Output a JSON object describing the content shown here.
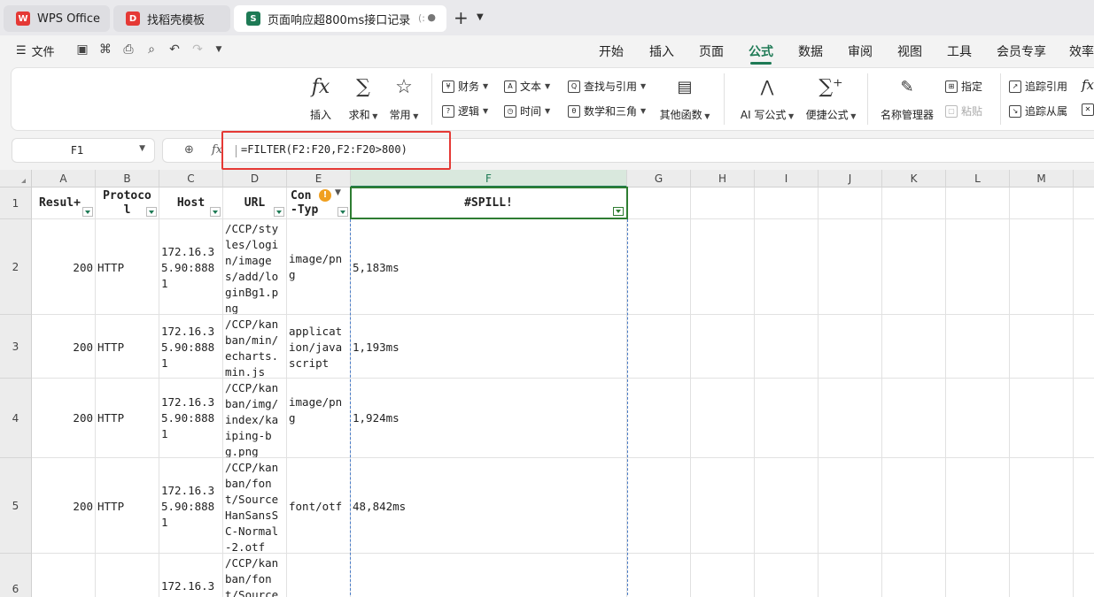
{
  "colors": {
    "accent": "#1e7a55",
    "highlight": "#e53935",
    "spill_border": "#4a7cc7",
    "warning": "#f0a020"
  },
  "tabs": {
    "wps": "WPS Office",
    "templates": "找稻壳模板",
    "doc": "页面响应超800ms接口记录",
    "doc_extra": "(: "
  },
  "menu": {
    "file": "文件",
    "tabs": [
      "开始",
      "插入",
      "页面",
      "公式",
      "数据",
      "审阅",
      "视图",
      "工具",
      "会员专享",
      "效率"
    ],
    "active": "公式"
  },
  "ribbon": {
    "insert": "插入",
    "sum": "求和",
    "common": "常用",
    "finance": "财务",
    "text": "文本",
    "lookup": "查找与引用",
    "other_funcs": "其他函数",
    "logic": "逻辑",
    "time": "时间",
    "math": "数学和三角",
    "ai_formula": "AI 写公式",
    "quick_formula": "便捷公式",
    "name_manager": "名称管理器",
    "assign": "指定",
    "paste": "粘贴",
    "trace_precedents": "追踪引用",
    "trace_dependents": "追踪从属",
    "fx_symbol": "fx",
    "sum_symbol": "∑"
  },
  "formula_bar": {
    "name_box": "F1",
    "formula": "=FILTER(F2:F20,F2:F20>800)",
    "fx_label": "fx"
  },
  "sheet": {
    "columns": [
      "A",
      "B",
      "C",
      "D",
      "E",
      "F",
      "G",
      "H",
      "I",
      "J",
      "K",
      "L",
      "M"
    ],
    "rows": [
      "1",
      "2",
      "3",
      "4",
      "5",
      "6"
    ],
    "headers": {
      "A": "Resul+",
      "B": "Protoco l",
      "C": "Host",
      "D": "URL",
      "E": "Con -Type",
      "F": "#SPILL!"
    },
    "data": [
      {
        "a": "200",
        "b": "HTTP",
        "c": "172.16.35.90:8881",
        "d": "/CCP/styles/login/images/add/loginBg1.png",
        "e": "image/png",
        "f": "5,183ms"
      },
      {
        "a": "200",
        "b": "HTTP",
        "c": "172.16.35.90:8881",
        "d": "/CCP/kanban/min/echarts.min.js",
        "e": "application/javascript",
        "f": "1,193ms"
      },
      {
        "a": "200",
        "b": "HTTP",
        "c": "172.16.35.90:8881",
        "d": "/CCP/kanban/img/index/kaiping-bg.png",
        "e": "image/png",
        "f": "1,924ms"
      },
      {
        "a": "200",
        "b": "HTTP",
        "c": "172.16.35.90:8881",
        "d": "/CCP/kanban/font/SourceHanSansSC-Normal-2.otf",
        "e": "font/otf",
        "f": "48,842ms"
      },
      {
        "a": "",
        "b": "",
        "c": "172.16.3",
        "d": "/CCP/kanban/font/SourceH",
        "e": "",
        "f": ""
      }
    ]
  }
}
